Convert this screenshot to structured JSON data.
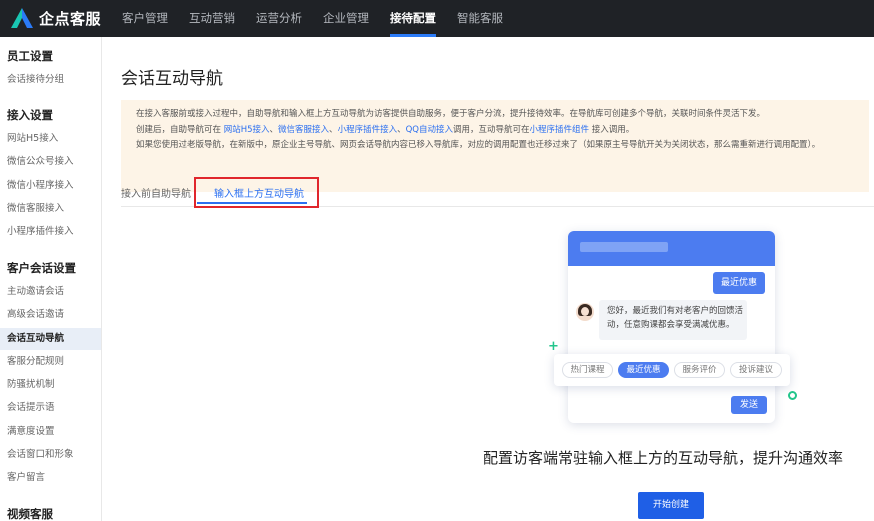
{
  "app": {
    "brand": "企点客服",
    "brand_color": "#2b7bf7",
    "nav": [
      "客户管理",
      "互动营销",
      "运营分析",
      "企业管理",
      "接待配置",
      "智能客服"
    ],
    "nav_active": "接待配置"
  },
  "sidebar": {
    "groups": [
      {
        "title": "员工设置",
        "items": [
          "会话接待分组"
        ]
      },
      {
        "title": "接入设置",
        "items": [
          "网站H5接入",
          "微信公众号接入",
          "微信小程序接入",
          "微信客服接入",
          "小程序插件接入"
        ]
      },
      {
        "title": "客户会话设置",
        "items": [
          "主动邀请会话",
          "高级会话邀请",
          "会话互动导航",
          "客服分配规则",
          "防骚扰机制",
          "会话提示语",
          "满意度设置",
          "会话窗口和形象",
          "客户留言"
        ]
      },
      {
        "title": "视频客服",
        "items": []
      }
    ],
    "active_item": "会话互动导航"
  },
  "main": {
    "title": "会话互动导航",
    "notice": {
      "line1": "在接入客服前或接入过程中，自助导航和输入框上方互动导航为访客提供自助服务，便于客户分流，提升接待效率。在导航库可创建多个导航，关联时间条件灵活下发。",
      "line2_prefix": "创建后，自助导航可在 ",
      "line2_links": [
        "网站H5接入",
        "微信客服接入",
        "小程序插件接入",
        "QQ自动接入"
      ],
      "line2_sep": "、",
      "line2_mid": "调用，互动导航可在",
      "line2_link_last": "小程序插件组件",
      "line2_suffix": " 接入调用。",
      "line3": "如果您使用过老版导航，在新版中，原企业主号导航、网页会话导航内容已移入导航库，对应的调用配置也迁移过来了（如果原主号导航开关为关闭状态，那么需重新进行调用配置）。"
    },
    "tabs": [
      "接入前自助导航",
      "输入框上方互动导航"
    ],
    "active_tab": "输入框上方互动导航",
    "illustration": {
      "agent_reply": "最近优惠",
      "bot_message": [
        "您好，最近我们有对老客户的回馈活",
        "动，任意购课都会享受满减优惠。"
      ],
      "chips": [
        "热门课程",
        "最近优惠",
        "服务评价",
        "投诉建议"
      ],
      "active_chip": "最近优惠",
      "send": "发送"
    },
    "slogan": "配置访客端常驻输入框上方的互动导航，提升沟通效率",
    "create_button": "开始创建"
  }
}
